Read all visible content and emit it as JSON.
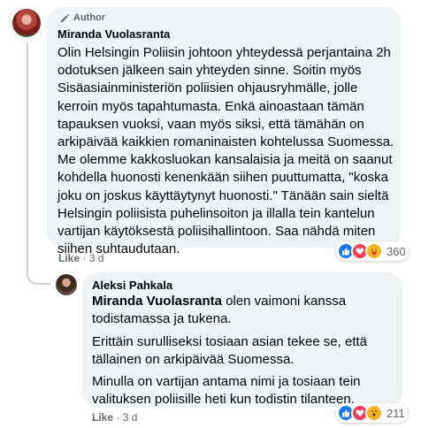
{
  "comment1": {
    "badge": "Author",
    "author": "Miranda Vuolasranta",
    "text": "Olin Helsingin Poliisin johtoon yhteydessä perjantaina 2h odotuksen jälkeen sain yhteyden sinne. Soitin myös Sisäasiainministeriön poliisien ohjausryhmälle, jolle kerroin myös tapahtumasta. Enkä ainoastaan tämän tapauksen vuoksi, vaan myös siksi, että tämähän on arkipäivää kaikkien romaninaisten kohtelussa Suomessa. Me olemme kakkosluokan kansalaisia ja meitä on saanut kohdella huonosti kenenkään siihen puuttumatta, \"koska joku on joskus käyttäytynyt huonosti.\" Tänään sain sieltä Helsingin poliisista puhelinsoiton ja illalla tein kantelun vartijan käytöksestä poliisihallintoon. Saa nähdä miten siihen suhtaudutaan.",
    "like_label": "Like",
    "time": "3 d",
    "reaction_count": "360",
    "reaction_icons": [
      "like-icon",
      "love-icon",
      "care-icon"
    ]
  },
  "comment2": {
    "author": "Aleksi Pahkala",
    "mention": "Miranda Vuolasranta",
    "para1_rest": " olen vaimoni kanssa todistamassa ja tukena.",
    "para2": "Erittäin surulliseksi tosiaan asian tekee se, että tällainen on arkipäivää Suomessa.",
    "para3": "Minulla on vartijan antama nimi ja tosiaan tein valituksen poliisille heti kun todistin tilanteen.",
    "like_label": "Like",
    "time": "3 d",
    "reaction_count": "211",
    "reaction_icons": [
      "like-icon",
      "love-icon",
      "wow-icon"
    ]
  },
  "separator": " · ",
  "colors": {
    "bubble": "#f0f2f5",
    "meta_text": "#65676b",
    "like_blue": "#1877f2",
    "love_red": "#f33e58",
    "reaction_yellow": "#f7b125"
  }
}
